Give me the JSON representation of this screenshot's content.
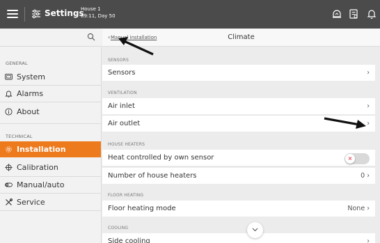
{
  "topbar": {
    "title": "Settings",
    "house_name": "House 1",
    "house_time": "09:11, Day 50",
    "icons": [
      "menu-icon",
      "settings-sliders-icon",
      "alarm-bell-icon",
      "notes-icon",
      "notification-bell-icon"
    ]
  },
  "sidebar": {
    "general_label": "GENERAL",
    "technical_label": "TECHNICAL",
    "items": [
      {
        "label": "System",
        "icon": "monitor-icon"
      },
      {
        "label": "Alarms",
        "icon": "bell-icon"
      },
      {
        "label": "About",
        "icon": "info-icon"
      },
      {
        "label": "Installation",
        "icon": "gear-icon",
        "active": true
      },
      {
        "label": "Calibration",
        "icon": "crosshair-icon"
      },
      {
        "label": "Manual/auto",
        "icon": "toggle-icon"
      },
      {
        "label": "Service",
        "icon": "tools-icon"
      }
    ]
  },
  "main": {
    "back_label": "Manual installation",
    "title": "Climate",
    "sections": {
      "sensors": "SENSORS",
      "ventilation": "VENTILATION",
      "house_heaters": "HOUSE HEATERS",
      "floor_heating": "FLOOR HEATING",
      "cooling": "COOLING"
    },
    "rows": {
      "sensors": "Sensors",
      "air_inlet": "Air inlet",
      "air_outlet": "Air outlet",
      "heat_controlled": "Heat controlled by own sensor",
      "num_heaters": "Number of house heaters",
      "num_heaters_value": "0",
      "floor_mode": "Floor heating mode",
      "floor_mode_value": "None",
      "side_cooling": "Side cooling"
    },
    "toggle_heat_controlled": false
  },
  "colors": {
    "topbar": "#4b4b4b",
    "accent": "#ee7a1e",
    "toggle_off_x": "#e8455b"
  }
}
